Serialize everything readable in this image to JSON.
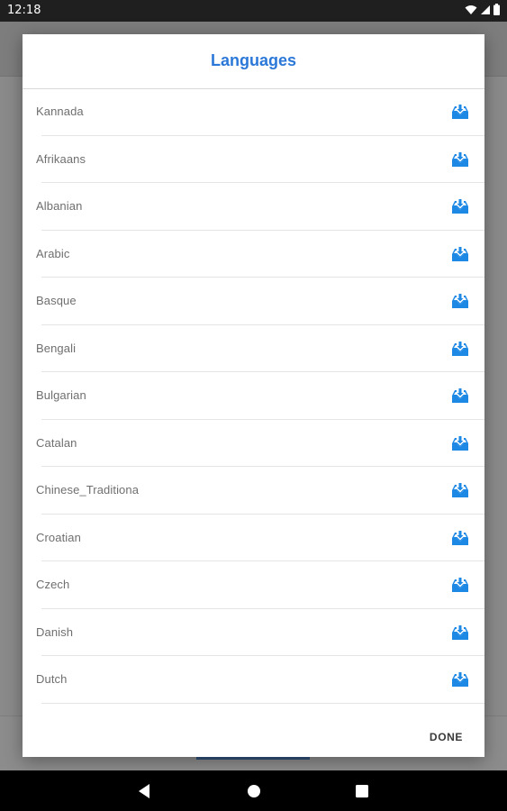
{
  "status_bar": {
    "time": "12:18",
    "icons": [
      "wifi-icon",
      "signal-icon",
      "battery-icon"
    ]
  },
  "dialog": {
    "title": "Languages",
    "languages": [
      {
        "label": "Kannada",
        "icon": "download-icon"
      },
      {
        "label": "Afrikaans",
        "icon": "download-icon"
      },
      {
        "label": "Albanian",
        "icon": "download-icon"
      },
      {
        "label": "Arabic",
        "icon": "download-icon"
      },
      {
        "label": "Basque",
        "icon": "download-icon"
      },
      {
        "label": "Bengali",
        "icon": "download-icon"
      },
      {
        "label": "Bulgarian",
        "icon": "download-icon"
      },
      {
        "label": "Catalan",
        "icon": "download-icon"
      },
      {
        "label": "Chinese_Traditiona",
        "icon": "download-icon"
      },
      {
        "label": "Croatian",
        "icon": "download-icon"
      },
      {
        "label": "Czech",
        "icon": "download-icon"
      },
      {
        "label": "Danish",
        "icon": "download-icon"
      },
      {
        "label": "Dutch",
        "icon": "download-icon"
      }
    ],
    "done_label": "DONE"
  },
  "nav_bar": {
    "icons": [
      "back-icon",
      "home-icon",
      "recents-icon"
    ]
  },
  "colors": {
    "accent": "#2b78d8",
    "icon_blue": "#1e88e5",
    "text_gray": "#6f6f6f"
  }
}
